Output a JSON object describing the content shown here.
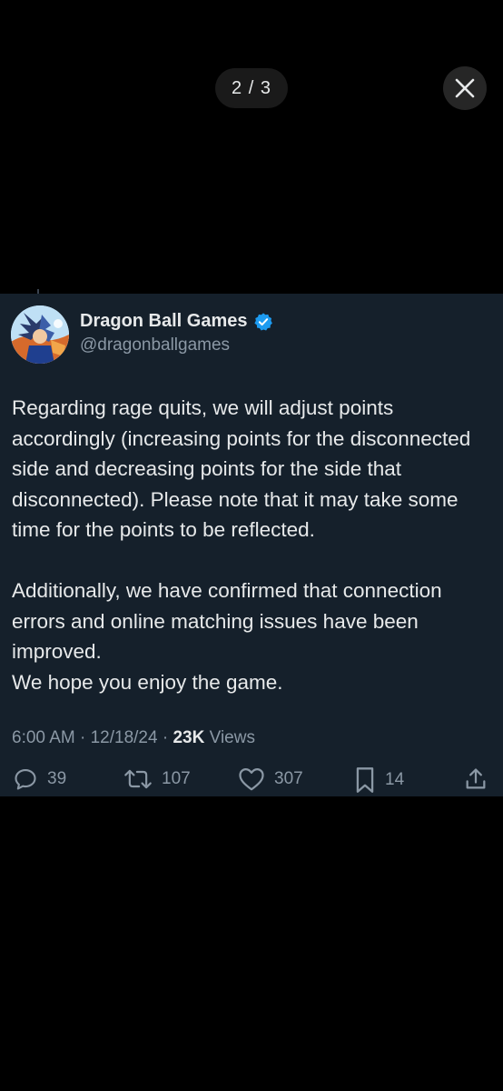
{
  "viewer": {
    "pager_label": "2 / 3",
    "close_icon": "close-icon"
  },
  "tweet": {
    "author": {
      "display_name": "Dragon Ball Games",
      "handle": "@dragonballgames",
      "verified": true,
      "verified_color": "#1d9bf0"
    },
    "paragraphs": [
      "Regarding rage quits, we will adjust points accordingly (increasing points for the disconnected side and decreasing points for the side that disconnected). Please note that it may take some time for the points to be reflected.",
      "Additionally, we have confirmed that connection errors and online matching issues have been improved.\nWe hope you enjoy the game."
    ],
    "meta": {
      "time": "6:00 AM",
      "separator": "·",
      "date": "12/18/24",
      "views_count": "23K",
      "views_label": "Views"
    },
    "actions": {
      "replies": "39",
      "retweets": "107",
      "likes": "307",
      "bookmarks": "14"
    }
  },
  "colors": {
    "page_background": "#000000",
    "card_background": "#15202b",
    "text_primary": "#e7e9ea",
    "text_secondary": "#8b98a5"
  }
}
